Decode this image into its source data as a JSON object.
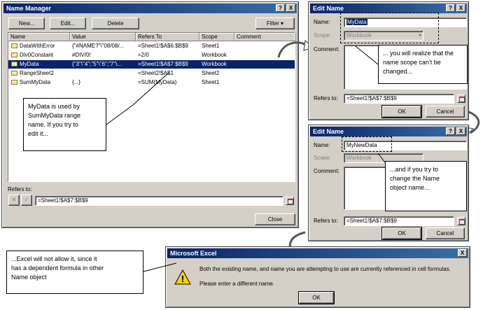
{
  "name_manager": {
    "title": "Name Manager",
    "new_label": "New...",
    "edit_label": "Edit...",
    "delete_label": "Delete",
    "filter_label": "Filter",
    "columns": [
      "Name",
      "Value",
      "Refers To",
      "Scope",
      "Comment"
    ],
    "rows": [
      {
        "name": "DataWithError",
        "value": "{\"#NAME?\"\\\"08/08/...",
        "refers": "=Sheet1!$A$6:$B$9",
        "scope": "Sheet1",
        "comment": ""
      },
      {
        "name": "Div0Constant",
        "value": "#DIV/0!",
        "refers": "=2/0",
        "scope": "Workbook",
        "comment": ""
      },
      {
        "name": "MyData",
        "value": "{\"3\"\\\"4\";\"5\"\\\"6\";\"7\"\\...",
        "refers": "=Sheet1!$A$7:$B$9",
        "scope": "Workbook",
        "comment": ""
      },
      {
        "name": "RangeSheet2",
        "value": "",
        "refers": "=Sheet2!$A$1",
        "scope": "Sheet2",
        "comment": ""
      },
      {
        "name": "SumMyData",
        "value": "{...}",
        "refers": "=SUM(MyData)",
        "scope": "Sheet1",
        "comment": ""
      }
    ],
    "refers_to_label": "Refers to:",
    "refers_to_value": "=Sheet1!$A$7:$B$9",
    "close_label": "Close",
    "help_glyph": "?",
    "close_glyph": "X",
    "cancel_glyph": "✕",
    "confirm_glyph": "✓"
  },
  "edit_name_1": {
    "title": "Edit Name",
    "name_label": "Name:",
    "name_value": "MyData",
    "scope_label": "Scope:",
    "scope_value": "Workbook",
    "comment_label": "Comment:",
    "refers_label": "Refers to:",
    "refers_value": "=Sheet1!$A$7:$B$9",
    "ok_label": "OK",
    "cancel_label": "Cancel"
  },
  "edit_name_2": {
    "title": "Edit Name",
    "name_label": "Name:",
    "name_value": "MyNewData",
    "scope_label": "Scope:",
    "scope_value": "Workbook",
    "comment_label": "Comment:",
    "refers_label": "Refers to:",
    "refers_value": "=Sheet1!$A$7:$B$9",
    "ok_label": "OK",
    "cancel_label": "Cancel"
  },
  "excel_alert": {
    "title": "Microsoft Excel",
    "message_line1": "Both the existing name, and name you are attempting to use are currently referenced in cell formulas.",
    "message_line2": "Please enter a different name.",
    "ok_label": "OK",
    "warning_glyph": "!"
  },
  "callouts": {
    "mydata": "MyData is used by\nSumMyData range\nname. If you try to\nedit it...",
    "scope": "... you will realize that the\nname scope can't be\nchanged...",
    "rename": "...and if you try to\nchange the Name\nobject name...",
    "excel": "...Excel will not allow it, since it\nhas a dependent formula in other\nName object"
  },
  "colors": {
    "dialog_bg": "#d4d0c8",
    "titlebar": "#0a246a",
    "selection": "#0a246a"
  }
}
